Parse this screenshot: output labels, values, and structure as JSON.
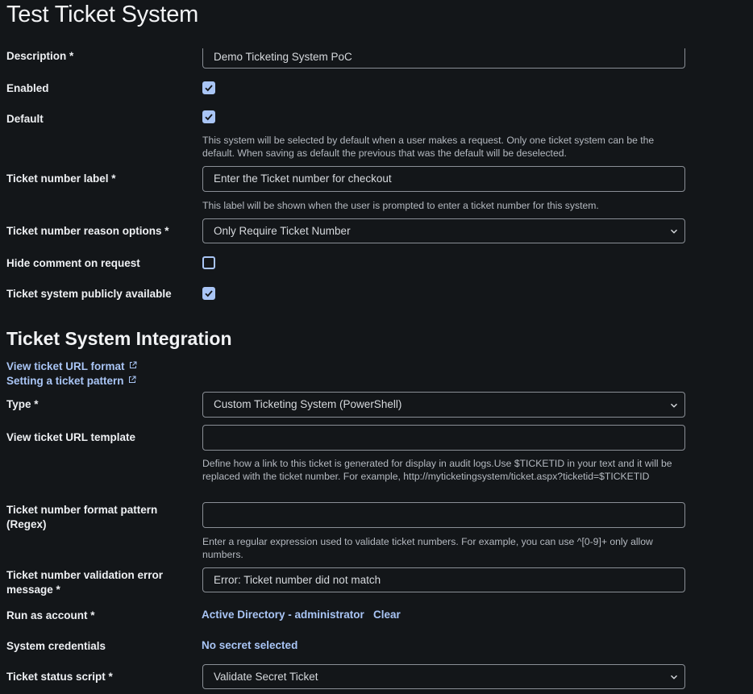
{
  "page": {
    "title": "Test Ticket System"
  },
  "form": {
    "description": {
      "label": "Description *",
      "value": "Demo Ticketing System PoC"
    },
    "enabled": {
      "label": "Enabled",
      "checked": true
    },
    "default": {
      "label": "Default",
      "checked": true,
      "help": "This system will be selected by default when a user makes a request. Only one ticket system can be the default. When saving as default the previous that was the default will be deselected."
    },
    "ticket_number_label": {
      "label": "Ticket number label *",
      "value": "Enter the Ticket number for checkout",
      "help": "This label will be shown when the user is prompted to enter a ticket number for this system."
    },
    "reason_options": {
      "label": "Ticket number reason options *",
      "value": "Only Require Ticket Number"
    },
    "hide_comment": {
      "label": "Hide comment on request",
      "checked": false
    },
    "publicly_available": {
      "label": "Ticket system publicly available",
      "checked": true
    }
  },
  "integration": {
    "title": "Ticket System Integration",
    "links": {
      "view_url_format": "View ticket URL format",
      "ticket_pattern": "Setting a ticket pattern"
    },
    "type": {
      "label": "Type *",
      "value": "Custom Ticketing System (PowerShell)"
    },
    "url_template": {
      "label": "View ticket URL template",
      "value": "",
      "help": "Define how a link to this ticket is generated for display in audit logs.Use $TICKETID in your text and it will be replaced with the ticket number. For example, http://myticketingsystem/ticket.aspx?ticketid=$TICKETID"
    },
    "format_pattern": {
      "label": "Ticket number format pattern (Regex)",
      "value": "",
      "help": "Enter a regular expression used to validate ticket numbers. For example, you can use ^[0-9]+ only allow numbers."
    },
    "validation_error": {
      "label": "Ticket number validation error message *",
      "value": "Error: Ticket number did not match"
    },
    "run_as": {
      "label": "Run as account *",
      "value": "Active Directory - administrator",
      "clear": "Clear"
    },
    "credentials": {
      "label": "System credentials",
      "value": "No secret selected"
    },
    "status_script": {
      "label": "Ticket status script *",
      "value": "Validate Secret Ticket"
    }
  },
  "colors": {
    "background": "#131619",
    "accent": "#a9c5f5",
    "border": "#8a8f96"
  }
}
